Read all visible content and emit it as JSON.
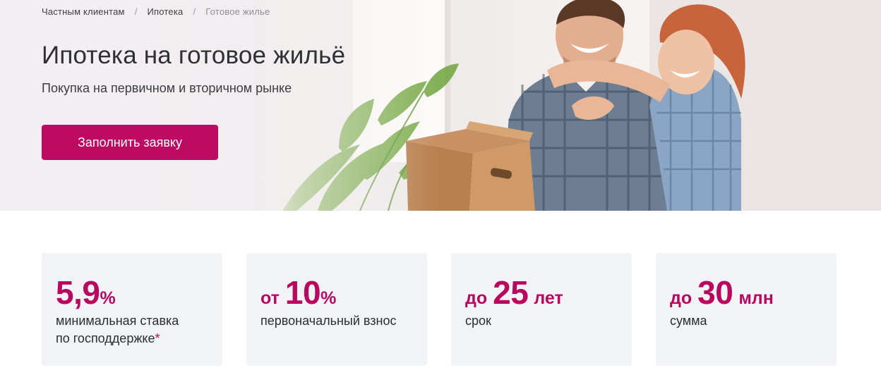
{
  "breadcrumb": {
    "items": [
      "Частным клиентам",
      "Ипотека",
      "Готовое жилье"
    ],
    "separator": "/"
  },
  "hero": {
    "title": "Ипотека на готовое жильё",
    "subtitle": "Покупка на первичном и вторичном рынке",
    "cta_label": "Заполнить заявку",
    "image": "smiling-couple-with-moving-box-photo"
  },
  "stats": [
    {
      "prefix": "",
      "number": "5,9",
      "suffix": "%",
      "desc_line1": "минимальная ставка",
      "desc_line2": "по господдержке",
      "footnote_mark": "*"
    },
    {
      "prefix": "от",
      "number": "10",
      "suffix": "%",
      "desc_line1": "первоначальный взнос"
    },
    {
      "prefix": "до",
      "number": "25",
      "suffix": "лет",
      "desc_line1": "срок"
    },
    {
      "prefix": "до",
      "number": "30",
      "suffix": "млн",
      "desc_line1": "сумма"
    }
  ],
  "colors": {
    "accent": "#bd0a63",
    "card_background": "#f1f3f7",
    "text": "#2b2d33"
  }
}
